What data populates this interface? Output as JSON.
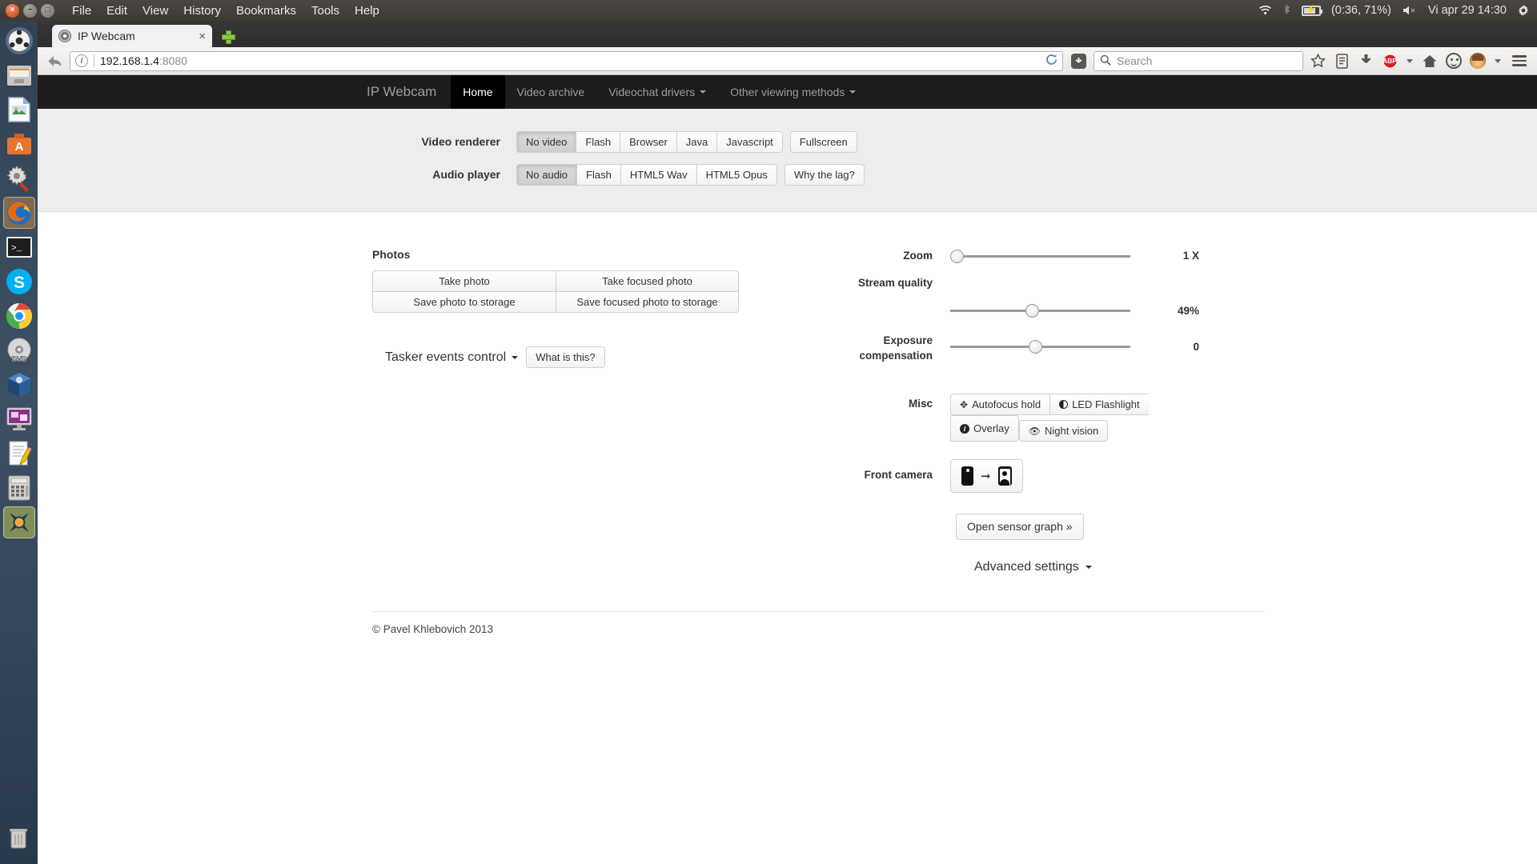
{
  "os_panel": {
    "menus": [
      "File",
      "Edit",
      "View",
      "History",
      "Bookmarks",
      "Tools",
      "Help"
    ],
    "window_controls": {
      "close": "close-icon",
      "minimize": "minimize-icon",
      "maximize": "maximize-icon"
    },
    "tray": {
      "wifi_icon": "wifi-icon",
      "bluetooth_icon": "bluetooth-icon",
      "battery_icon": "battery-charging-icon",
      "battery_text": "(0:36, 71%)",
      "volume_icon": "volume-muted-icon",
      "clock": "Vi apr 29 14:30",
      "gear_icon": "gear-icon"
    }
  },
  "launcher": {
    "items": [
      {
        "name": "ubuntu-dash",
        "label": "Dash home"
      },
      {
        "name": "files",
        "label": "Files"
      },
      {
        "name": "libreoffice-impress",
        "label": "LibreOffice Impress"
      },
      {
        "name": "ubuntu-software",
        "label": "Ubuntu Software Center"
      },
      {
        "name": "system-tools",
        "label": "System tools"
      },
      {
        "name": "firefox",
        "label": "Firefox"
      },
      {
        "name": "terminal",
        "label": "Terminal"
      },
      {
        "name": "skype",
        "label": "Skype"
      },
      {
        "name": "chrome",
        "label": "Google Chrome"
      },
      {
        "name": "dvd-player",
        "label": "DVD player"
      },
      {
        "name": "virtualbox",
        "label": "VirtualBox"
      },
      {
        "name": "remote-desktop",
        "label": "Remote desktop"
      },
      {
        "name": "text-editor",
        "label": "Text editor"
      },
      {
        "name": "calculator",
        "label": "Calculator"
      },
      {
        "name": "ktorrent",
        "label": "KTorrent"
      },
      {
        "name": "trash",
        "label": "Trash"
      }
    ]
  },
  "browser": {
    "tab": {
      "title": "IP Webcam",
      "close_label": "×"
    },
    "newtab_label": "+",
    "url": {
      "host": "192.168.1.4",
      "port": ":8080"
    },
    "search_placeholder": "Search",
    "toolbar_icons": [
      "back-icon",
      "identity-icon",
      "reload-icon",
      "download-badge-icon",
      "search-icon",
      "bookmark-star-icon",
      "reading-list-icon",
      "downloads-icon",
      "adblock-icon",
      "home-icon",
      "smiley-icon",
      "profile-avatar-icon",
      "menu-hamburger-icon"
    ],
    "adblock_label": "ABP"
  },
  "site": {
    "brand": "IP Webcam",
    "nav": [
      {
        "label": "Home",
        "active": true,
        "caret": false
      },
      {
        "label": "Video archive",
        "active": false,
        "caret": false
      },
      {
        "label": "Videochat drivers",
        "active": false,
        "caret": true
      },
      {
        "label": "Other viewing methods",
        "active": false,
        "caret": true
      }
    ],
    "video_renderer": {
      "label": "Video renderer",
      "group1": [
        {
          "label": "No video",
          "pressed": true
        },
        {
          "label": "Flash",
          "pressed": false
        },
        {
          "label": "Browser",
          "pressed": false
        },
        {
          "label": "Java",
          "pressed": false
        },
        {
          "label": "Javascript",
          "pressed": false
        }
      ],
      "group2": [
        {
          "label": "Fullscreen",
          "pressed": false
        }
      ]
    },
    "audio_player": {
      "label": "Audio player",
      "group1": [
        {
          "label": "No audio",
          "pressed": true
        },
        {
          "label": "Flash",
          "pressed": false
        },
        {
          "label": "HTML5 Wav",
          "pressed": false
        },
        {
          "label": "HTML5 Opus",
          "pressed": false
        }
      ],
      "group2": [
        {
          "label": "Why the lag?",
          "pressed": false
        }
      ]
    },
    "photos": {
      "title": "Photos",
      "buttons": [
        "Take photo",
        "Take focused photo",
        "Save photo to storage",
        "Save focused photo to storage"
      ]
    },
    "tasker": {
      "label": "Tasker events control",
      "help_button": "What is this?"
    },
    "controls": [
      {
        "label": "Zoom",
        "value": "1 X",
        "percent": 0
      },
      {
        "label": "Stream quality",
        "value": "49%",
        "percent": 49
      },
      {
        "label": "Exposure compensation",
        "value": "0",
        "percent": 50
      }
    ],
    "misc": {
      "label": "Misc",
      "buttons": [
        {
          "label": "Autofocus hold",
          "icon": "move-crosshair-icon"
        },
        {
          "label": "LED Flashlight",
          "icon": "contrast-icon"
        },
        {
          "label": "Overlay",
          "icon": "info-icon"
        },
        {
          "label": "Night vision",
          "icon": "eye-icon"
        }
      ]
    },
    "front_camera": {
      "label": "Front camera",
      "icons": [
        "phone-back-camera-icon",
        "arrow-right-icon",
        "phone-front-camera-icon"
      ]
    },
    "sensor_graph_button": "Open sensor graph »",
    "advanced_settings": "Advanced settings",
    "footer": "© Pavel Khlebovich 2013"
  }
}
